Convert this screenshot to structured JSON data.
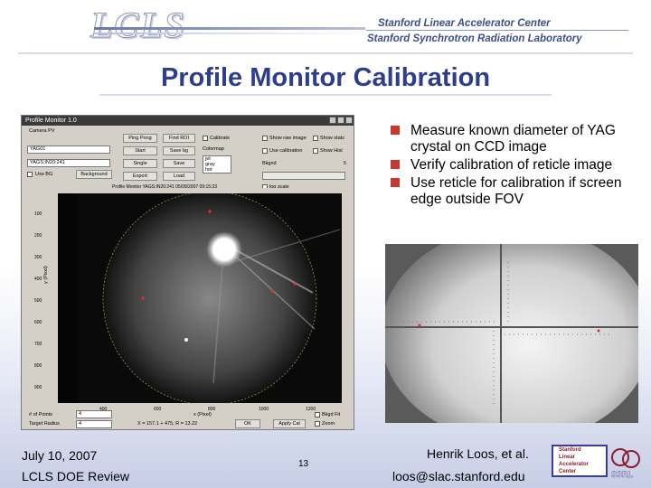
{
  "header": {
    "logo_text": "LCLS",
    "org_line1": "Stanford Linear Accelerator Center",
    "org_line2": "Stanford Synchrotron Radiation Laboratory"
  },
  "slide": {
    "title": "Profile Monitor Calibration",
    "bullets": [
      "Measure known diameter of YAG crystal on CCD image",
      "Verify calibration of reticle image",
      "Use reticle for calibration if screen edge outside FOV"
    ],
    "bullet_color": "#c8382c",
    "title_color": "#2e3e8c"
  },
  "app": {
    "window_title": "Profile Monitor 1.0",
    "camera_label": "Camera PV",
    "camera_value": "YAG01",
    "pv_value": "YAGS:IN20:241",
    "use_bg_label": "Use BG",
    "buttons": {
      "ring_pong": "Ping Pong",
      "start": "Start",
      "single": "Single",
      "export": "Export",
      "find_roi": "Find ROI",
      "save_bg": "Save bg",
      "save": "Save",
      "load": "Load",
      "background": "Background",
      "ok": "OK",
      "apply_cal": "Apply Cal"
    },
    "checks": {
      "calibrate": "Calibrate",
      "show_raw": "Show raw image",
      "use_calibration": "Use calibration",
      "show_stats": "Show stats",
      "show_hist": "Show Hist",
      "log_scale": "log scale"
    },
    "colormap_label": "Colormap",
    "colormap_options": [
      "jet",
      "gray",
      "hot"
    ],
    "bg_label": "Bkgnd",
    "bg_value": "5",
    "status_line": "Profile Monitor YAGS:IN20:241 05/09/2007 09:15:23",
    "y_axis_label": "y (Pixel)",
    "x_axis_label": "x (Pixel)",
    "y_ticks": [
      "100",
      "200",
      "300",
      "400",
      "500",
      "600",
      "700",
      "800",
      "900"
    ],
    "x_ticks": [
      "400",
      "600",
      "800",
      "1000",
      "1200"
    ],
    "num_points_label": "# of Points",
    "num_points_value": "4",
    "target_radius_label": "Target Radius",
    "target_radius_value": "4",
    "readout": "X = 157.1 + 475, R = 13.22",
    "right_checks": [
      "Bkgd Fit",
      "Zoom"
    ]
  },
  "footer": {
    "date": "July 10, 2007",
    "event": "LCLS DOE Review",
    "page_number": "13",
    "author": "Henrik Loos, et al.",
    "email": "loos@slac.stanford.edu",
    "slac_logo_lines": [
      "Stanford",
      "Linear",
      "Accelerator",
      "Center"
    ],
    "ssrl_label": "SSRL"
  }
}
